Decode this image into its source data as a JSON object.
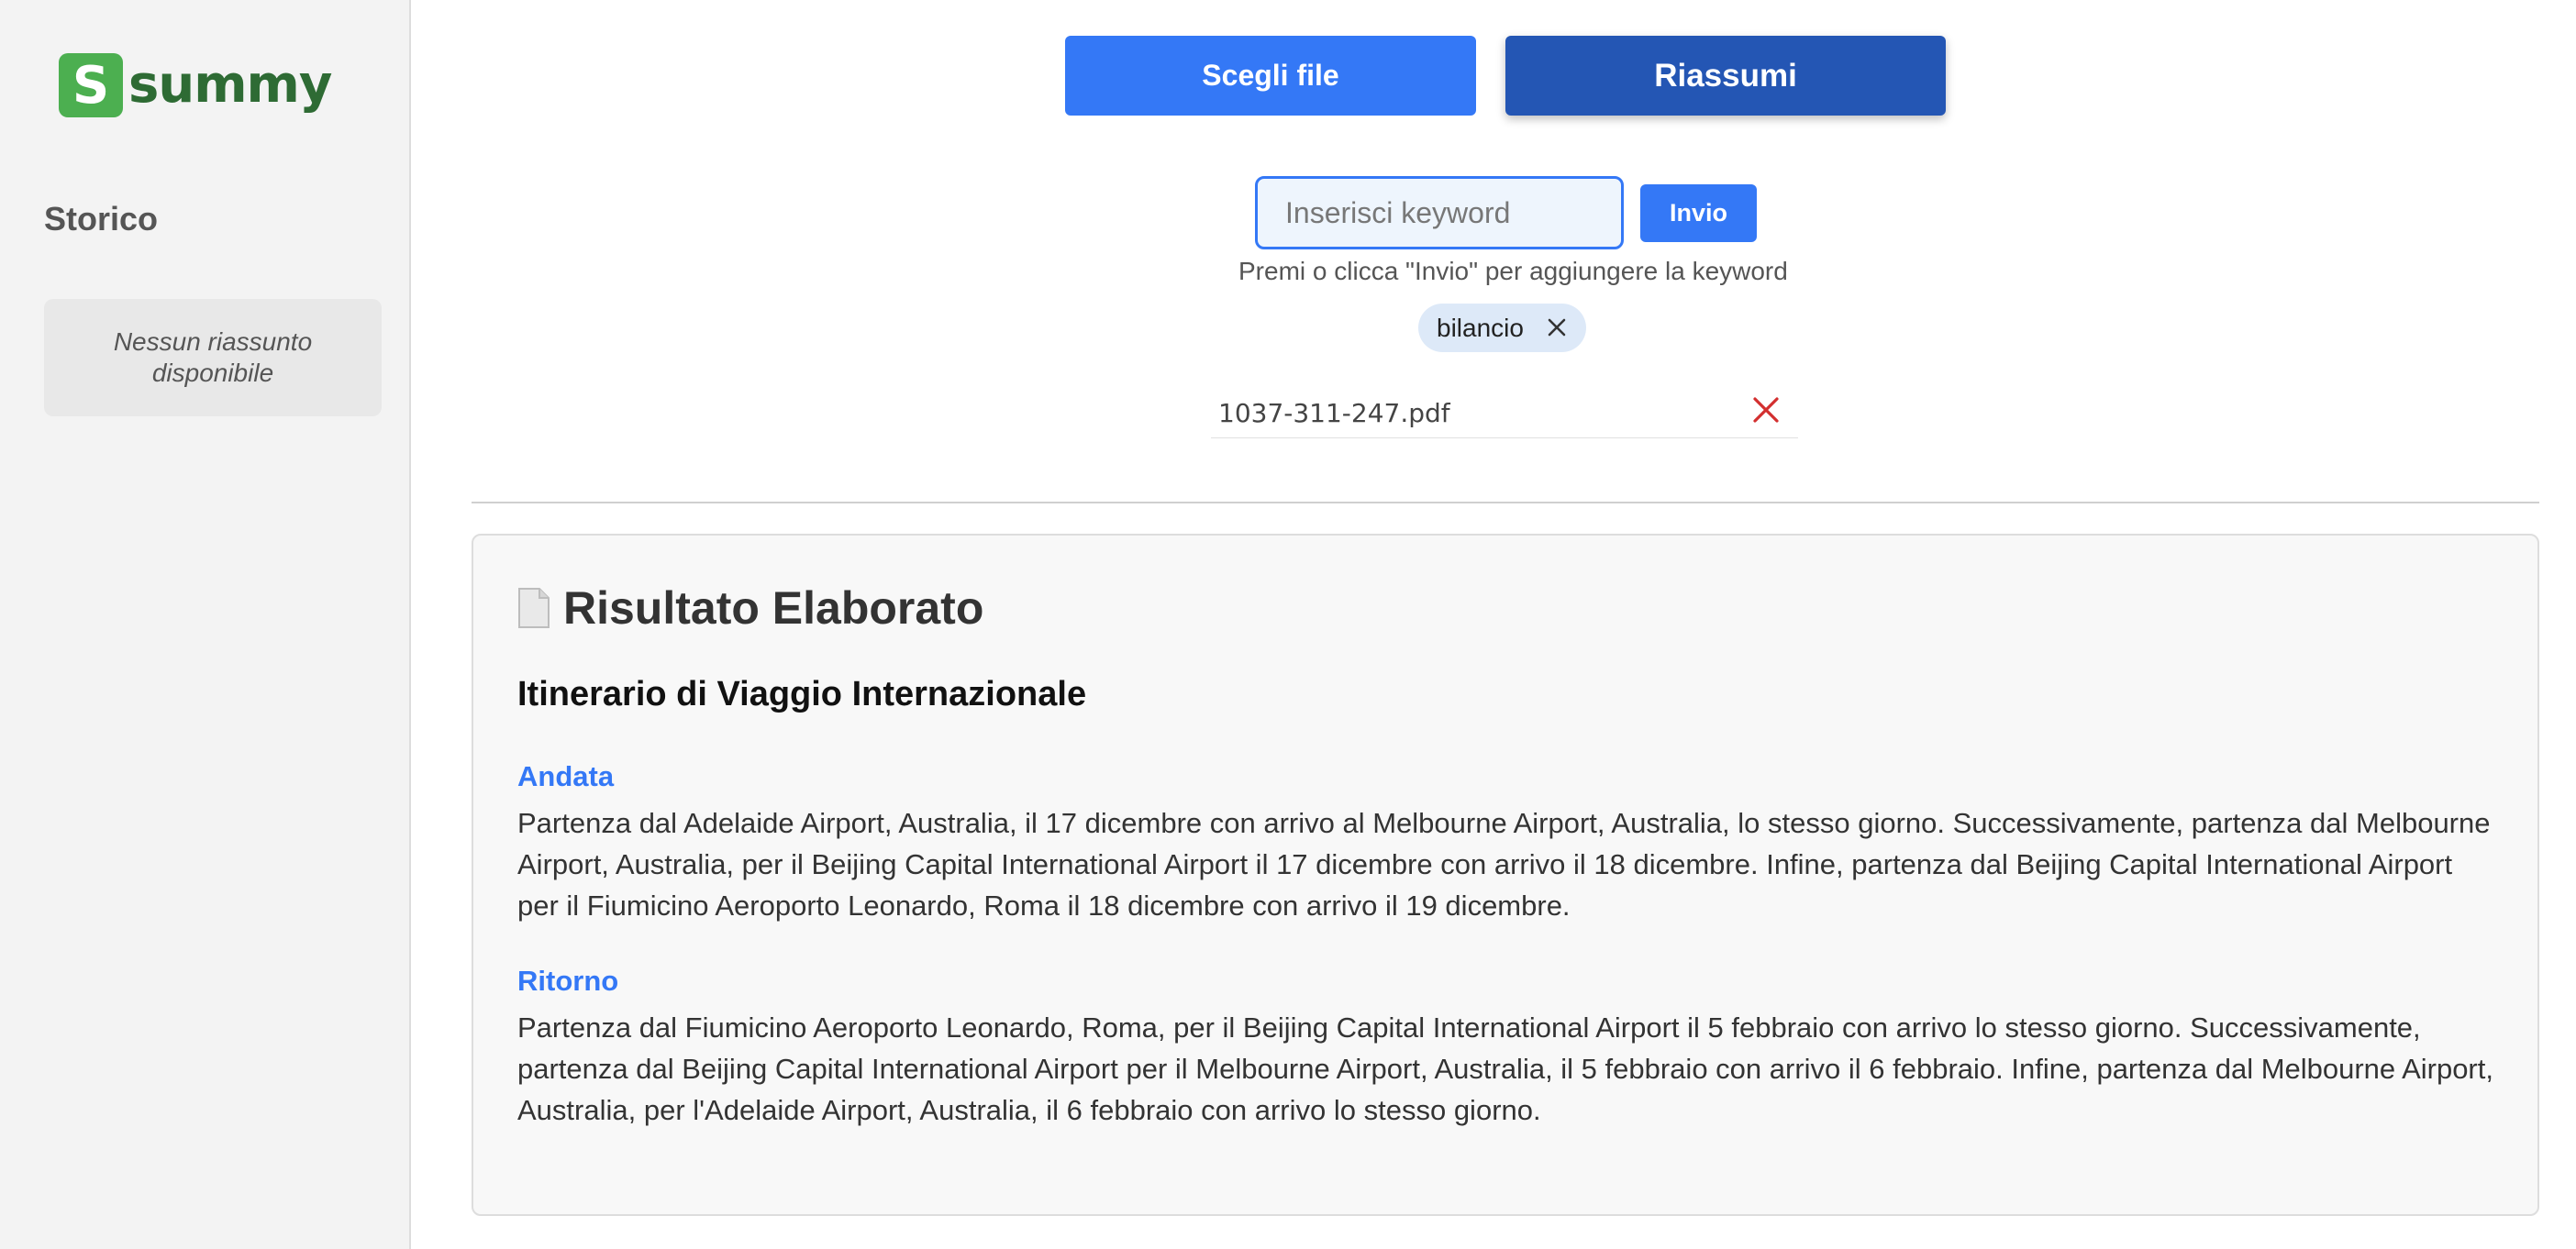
{
  "brand": {
    "logo_letter": "S",
    "name": "summy",
    "logo_color": "#4caf50"
  },
  "sidebar": {
    "history_title": "Storico",
    "empty_message": "Nessun riassunto disponibile"
  },
  "toolbar": {
    "choose_file_label": "Scegli file",
    "summarize_label": "Riassumi"
  },
  "keyword": {
    "input_placeholder": "Inserisci keyword",
    "input_value": "",
    "send_label": "Invio",
    "hint": "Premi o clicca \"Invio\" per aggiungere la keyword",
    "chips": [
      {
        "label": "bilancio",
        "remove_icon": "close-icon"
      }
    ]
  },
  "file": {
    "name": "1037-311-247.pdf",
    "remove_icon": "close-icon"
  },
  "result": {
    "icon": "document-icon",
    "title": "Risultato Elaborato",
    "heading": "Itinerario di Viaggio Internazionale",
    "sections": [
      {
        "title": "Andata",
        "text": "Partenza dal Adelaide Airport, Australia, il 17 dicembre con arrivo al Melbourne Airport, Australia, lo stesso giorno. Successivamente, partenza dal Melbourne Airport, Australia, per il Beijing Capital International Airport il 17 dicembre con arrivo il 18 dicembre. Infine, partenza dal Beijing Capital International Airport per il Fiumicino Aeroporto Leonardo, Roma il 18 dicembre con arrivo il 19 dicembre."
      },
      {
        "title": "Ritorno",
        "text": "Partenza dal Fiumicino Aeroporto Leonardo, Roma, per il Beijing Capital International Airport il 5 febbraio con arrivo lo stesso giorno. Successivamente, partenza dal Beijing Capital International Airport per il Melbourne Airport, Australia, il 5 febbraio con arrivo il 6 febbraio. Infine, partenza dal Melbourne Airport, Australia, per l'Adelaide Airport, Australia, il 6 febbraio con arrivo lo stesso giorno."
      }
    ]
  },
  "colors": {
    "primary": "#3478f6",
    "primary_dark": "#2456b4",
    "danger": "#d32f2f",
    "chip_bg": "#dde9f8"
  }
}
